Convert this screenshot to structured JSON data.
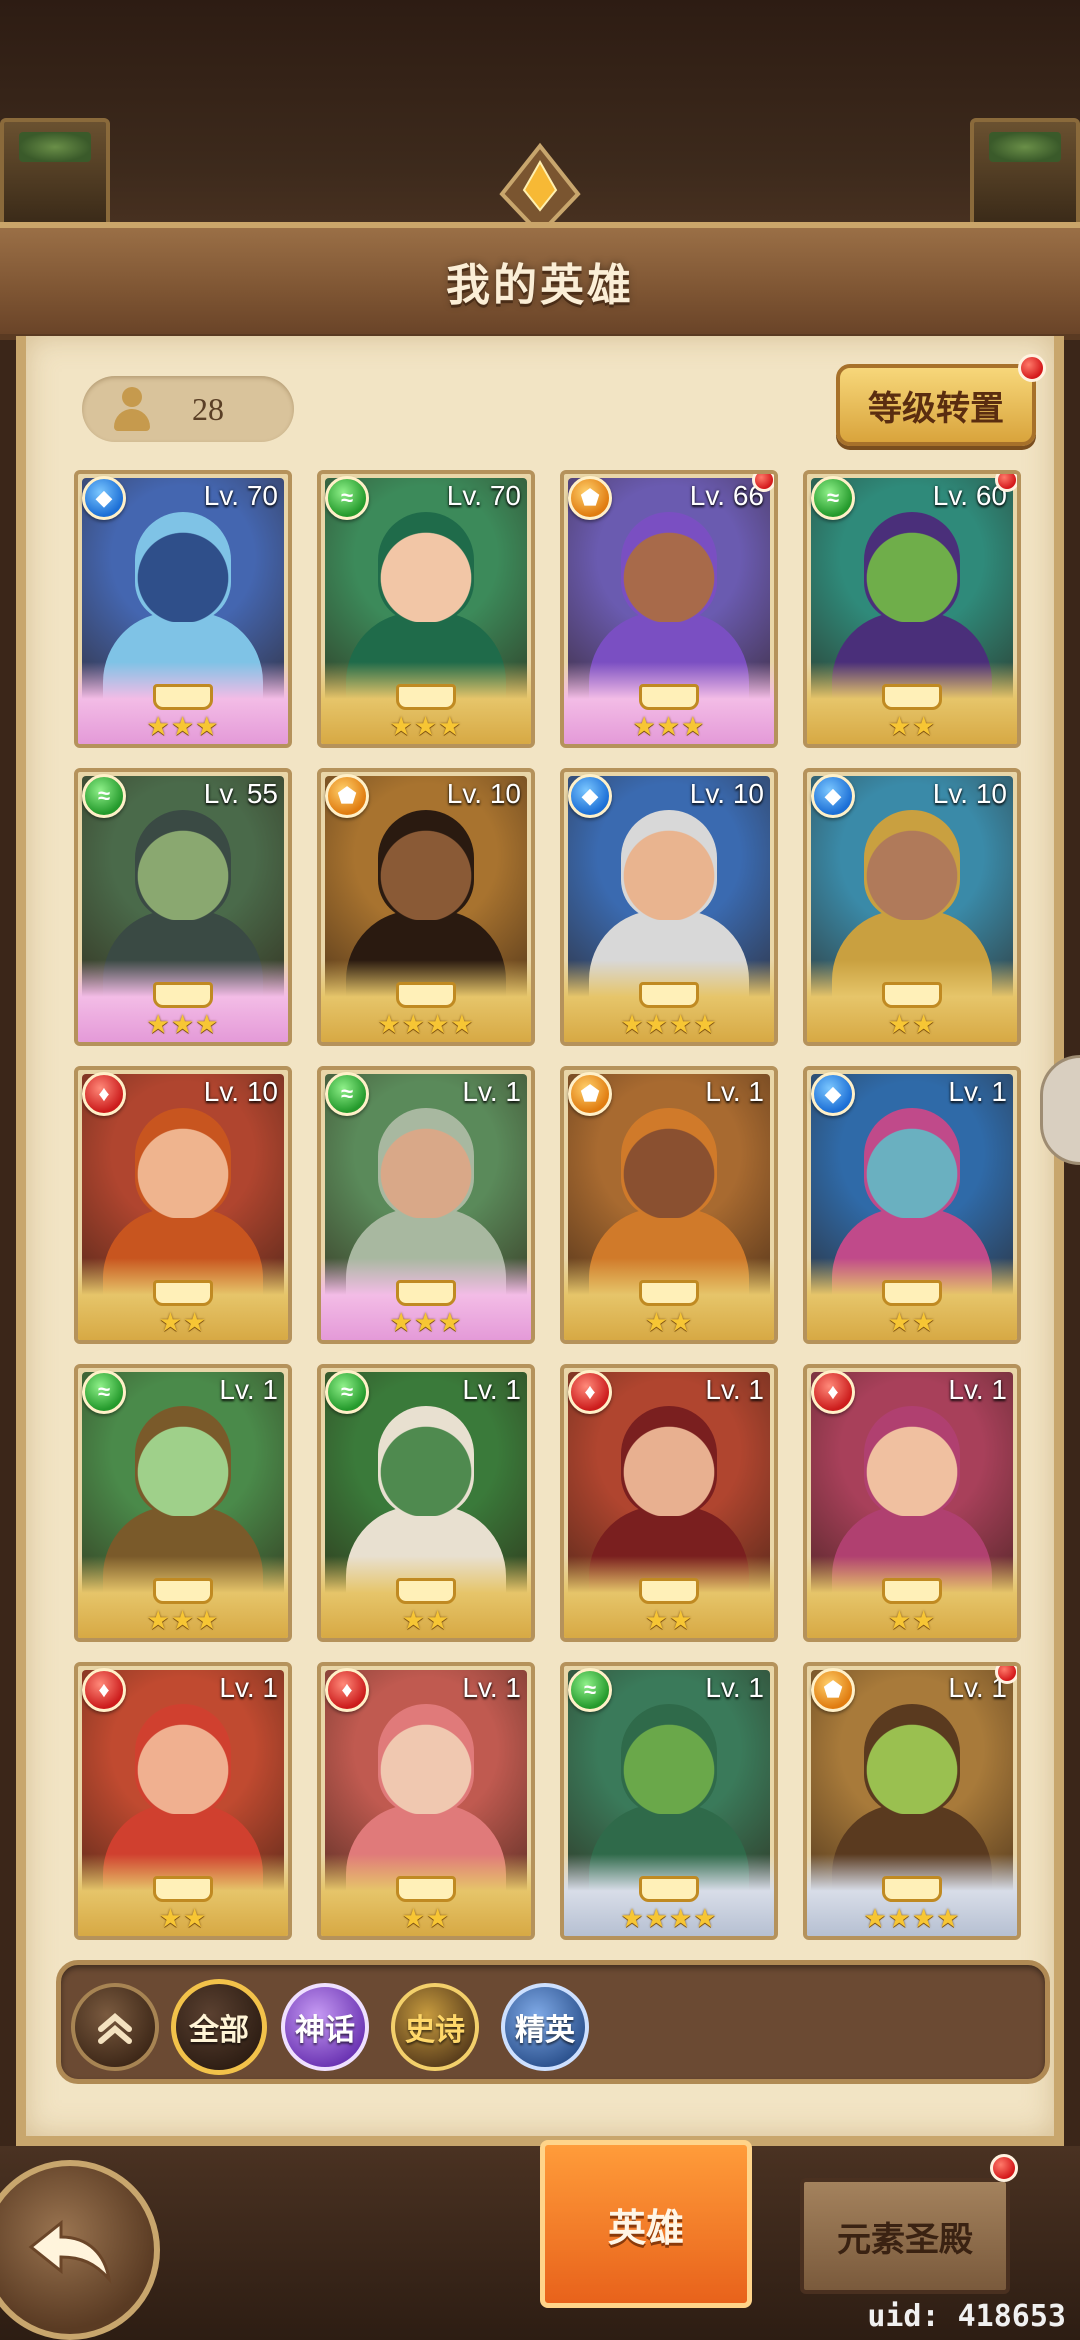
{
  "header": {
    "title": "我的英雄"
  },
  "hero_count": "28",
  "level_reset_button": "等级转置",
  "heroes": [
    {
      "level": "Lv. 70",
      "element": "water",
      "stars": "★★★",
      "rarity": "mythic",
      "skin": "#2f4f8a",
      "hair": "#7fc3e6",
      "bg": "#4466b0",
      "badge": false
    },
    {
      "level": "Lv. 70",
      "element": "wind",
      "stars": "★★★",
      "rarity": "legend",
      "skin": "#f2c6a6",
      "hair": "#1f6b4a",
      "bg": "#3c8a5a",
      "badge": false
    },
    {
      "level": "Lv. 66",
      "element": "earth",
      "stars": "★★★",
      "rarity": "mythic",
      "skin": "#a86a4a",
      "hair": "#7a4fc2",
      "bg": "#6a5bb0",
      "badge": true
    },
    {
      "level": "Lv. 60",
      "element": "wind",
      "stars": "★★",
      "rarity": "legend",
      "skin": "#6fae4a",
      "hair": "#4a2f7a",
      "bg": "#2f8a7a",
      "badge": true
    },
    {
      "level": "Lv. 55",
      "element": "wind",
      "stars": "★★★",
      "rarity": "mythic",
      "skin": "#8aa870",
      "hair": "#3a4a44",
      "bg": "#4a6a4a",
      "badge": false
    },
    {
      "level": "Lv. 10",
      "element": "earth",
      "stars": "★★★★",
      "rarity": "legend",
      "skin": "#8a5a36",
      "hair": "#2a1a10",
      "bg": "#a8732f",
      "badge": false
    },
    {
      "level": "Lv. 10",
      "element": "water",
      "stars": "★★★★",
      "rarity": "legend",
      "skin": "#e9b48f",
      "hair": "#d8d8d8",
      "bg": "#3a6ab0",
      "badge": false
    },
    {
      "level": "Lv. 10",
      "element": "water",
      "stars": "★★",
      "rarity": "legend",
      "skin": "#b07a5a",
      "hair": "#c9a040",
      "bg": "#3a8aa8",
      "badge": false
    },
    {
      "level": "Lv. 10",
      "element": "fire",
      "stars": "★★",
      "rarity": "legend",
      "skin": "#efb48e",
      "hair": "#c8551f",
      "bg": "#b0452f",
      "badge": false
    },
    {
      "level": "Lv. 1",
      "element": "wind",
      "stars": "★★★",
      "rarity": "mythic",
      "skin": "#d9a888",
      "hair": "#a8b8a0",
      "bg": "#5a8a5a",
      "badge": false
    },
    {
      "level": "Lv. 1",
      "element": "earth",
      "stars": "★★",
      "rarity": "legend",
      "skin": "#8a5030",
      "hair": "#d07a2a",
      "bg": "#a86a30",
      "badge": false
    },
    {
      "level": "Lv. 1",
      "element": "water",
      "stars": "★★",
      "rarity": "legend",
      "skin": "#6ab0c0",
      "hair": "#c04a8a",
      "bg": "#2f6aa8",
      "badge": false
    },
    {
      "level": "Lv. 1",
      "element": "wind",
      "stars": "★★★",
      "rarity": "legend",
      "skin": "#9fd08a",
      "hair": "#7a5a2a",
      "bg": "#4a8a4a",
      "badge": false
    },
    {
      "level": "Lv. 1",
      "element": "wind",
      "stars": "★★",
      "rarity": "legend",
      "skin": "#4f8a4f",
      "hair": "#e8e0d0",
      "bg": "#3a7a3a",
      "badge": false
    },
    {
      "level": "Lv. 1",
      "element": "fire",
      "stars": "★★",
      "rarity": "legend",
      "skin": "#e8b090",
      "hair": "#7a1f1f",
      "bg": "#b0452f",
      "badge": false
    },
    {
      "level": "Lv. 1",
      "element": "fire",
      "stars": "★★",
      "rarity": "legend",
      "skin": "#f0c0a0",
      "hair": "#b04070",
      "bg": "#a8405a",
      "badge": false
    },
    {
      "level": "Lv. 1",
      "element": "fire",
      "stars": "★★",
      "rarity": "legend",
      "skin": "#f0b090",
      "hair": "#d0402f",
      "bg": "#c04a30",
      "badge": false
    },
    {
      "level": "Lv. 1",
      "element": "fire",
      "stars": "★★",
      "rarity": "legend",
      "skin": "#f0c8b0",
      "hair": "#e07a7a",
      "bg": "#c05a50",
      "badge": false
    },
    {
      "level": "Lv. 1",
      "element": "wind",
      "stars": "★★★★",
      "rarity": "elite",
      "skin": "#6aa84a",
      "hair": "#2f6a4a",
      "bg": "#3a7a5a",
      "badge": false
    },
    {
      "level": "Lv. 1",
      "element": "earth",
      "stars": "★★★★",
      "rarity": "elite",
      "skin": "#9ac050",
      "hair": "#5a3a1f",
      "bg": "#a87a3a",
      "badge": true
    }
  ],
  "filters": {
    "collapse_icon": "double-chevron-up-icon",
    "all": "全部",
    "mythic": "神话",
    "epic": "史诗",
    "elite": "精英"
  },
  "bottom_nav": {
    "back_icon": "back-arrow-icon",
    "heroes_tab": "英雄",
    "element_temple_tab": "元素圣殿"
  },
  "uid": "uid: 418653",
  "colors": {
    "parchment": "#f2e4c4",
    "active_tab": "#e8621b",
    "badge_red": "#d4181a"
  }
}
